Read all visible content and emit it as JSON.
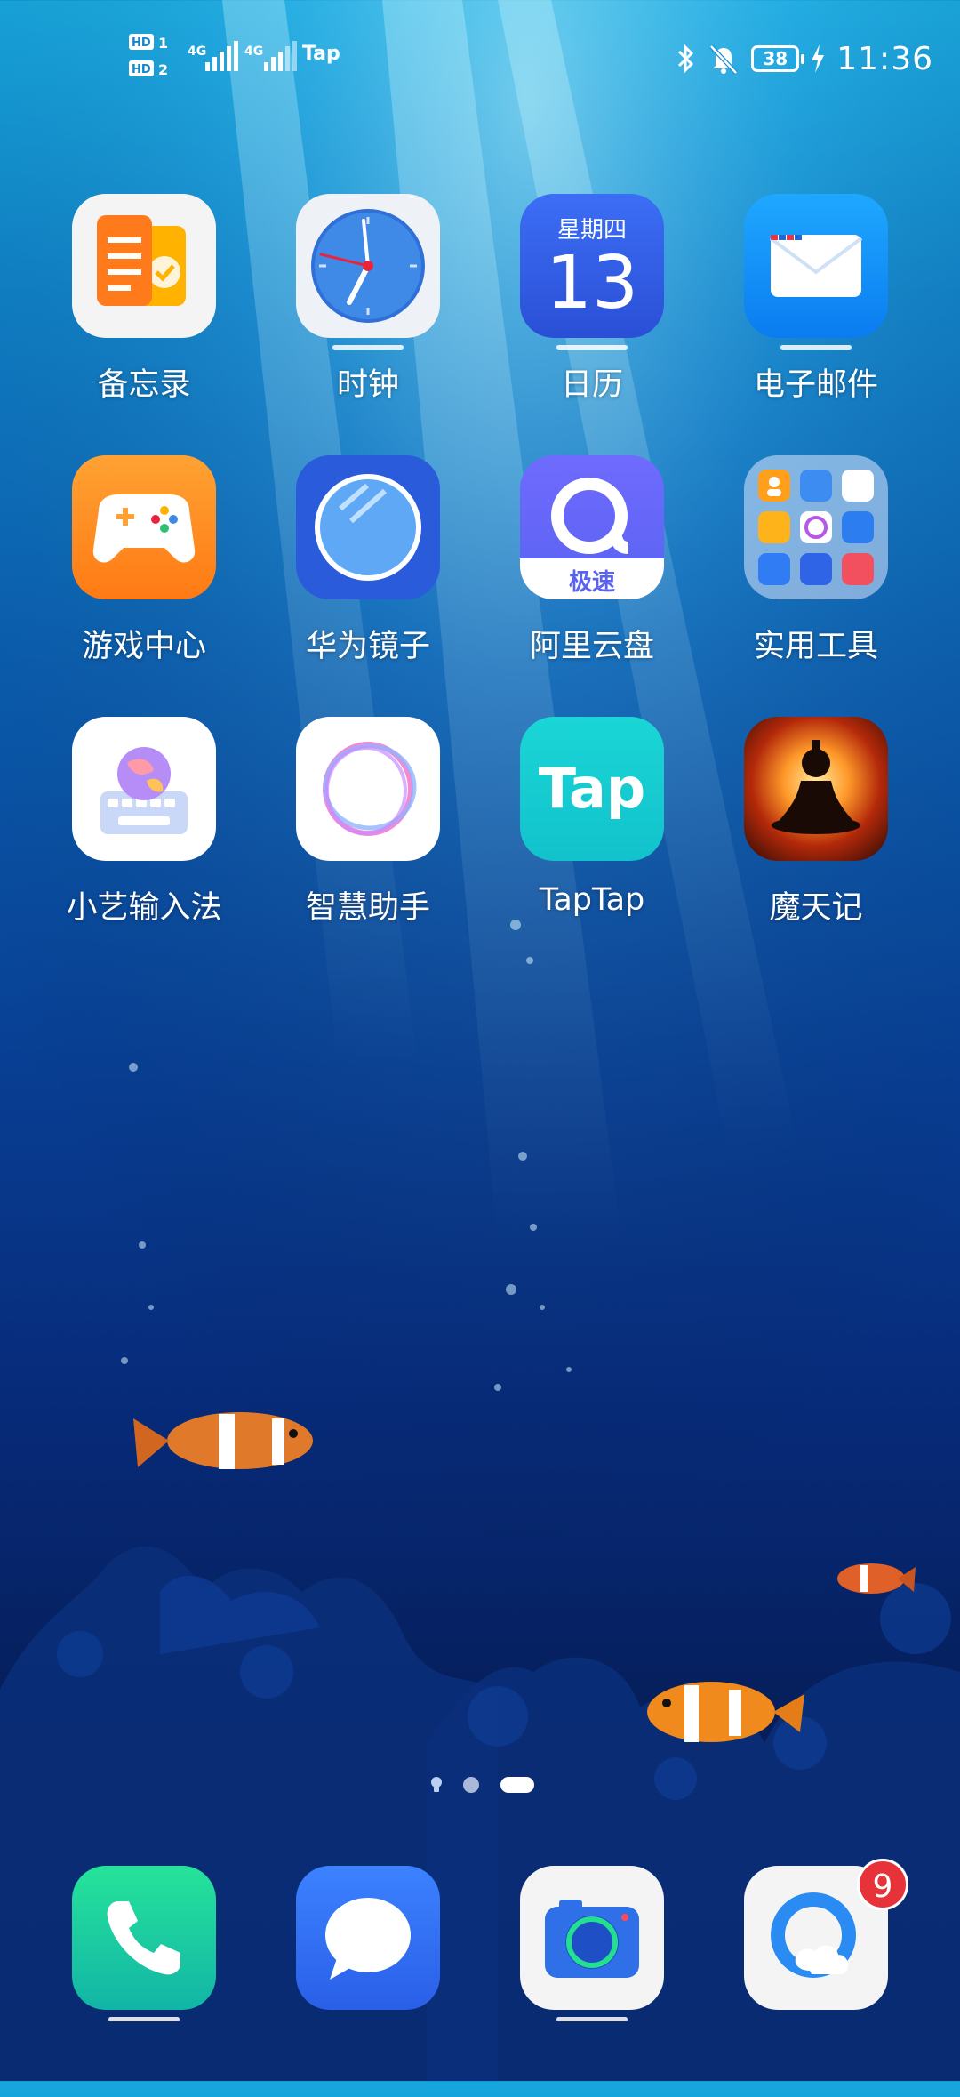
{
  "status_bar": {
    "sim1": "HD 1",
    "sim2": "HD 2",
    "network_4g_1": "4G",
    "network_4g_2": "4G",
    "notification_app": "Tap",
    "battery": "38",
    "time": "11:36",
    "icons": [
      "bluetooth-icon",
      "silent-bell-icon",
      "battery-icon",
      "charging-bolt-icon"
    ]
  },
  "apps": [
    {
      "label": "备忘录",
      "icon": "memo-icon"
    },
    {
      "label": "时钟",
      "icon": "clock-icon"
    },
    {
      "label": "日历",
      "icon": "calendar-icon",
      "weekday": "星期四",
      "day": "13"
    },
    {
      "label": "电子邮件",
      "icon": "email-icon"
    },
    {
      "label": "游戏中心",
      "icon": "gamepad-icon"
    },
    {
      "label": "华为镜子",
      "icon": "mirror-icon"
    },
    {
      "label": "阿里云盘",
      "icon": "aliyun-drive-icon",
      "tag": "极速"
    },
    {
      "label": "实用工具",
      "icon": "tools-folder-icon"
    },
    {
      "label": "小艺输入法",
      "icon": "keyboard-icon"
    },
    {
      "label": "智慧助手",
      "icon": "assistant-ring-icon"
    },
    {
      "label": "TapTap",
      "icon": "taptap-icon",
      "logo_text": "Tap"
    },
    {
      "label": "魔天记",
      "icon": "game-mtj-icon"
    }
  ],
  "page_indicator": {
    "pages": 3,
    "current": 3
  },
  "dock": [
    {
      "name": "phone",
      "icon": "phone-icon"
    },
    {
      "name": "messages",
      "icon": "message-bubble-icon"
    },
    {
      "name": "camera",
      "icon": "camera-icon"
    },
    {
      "name": "browser",
      "icon": "browser-icon",
      "badge": "9"
    }
  ]
}
